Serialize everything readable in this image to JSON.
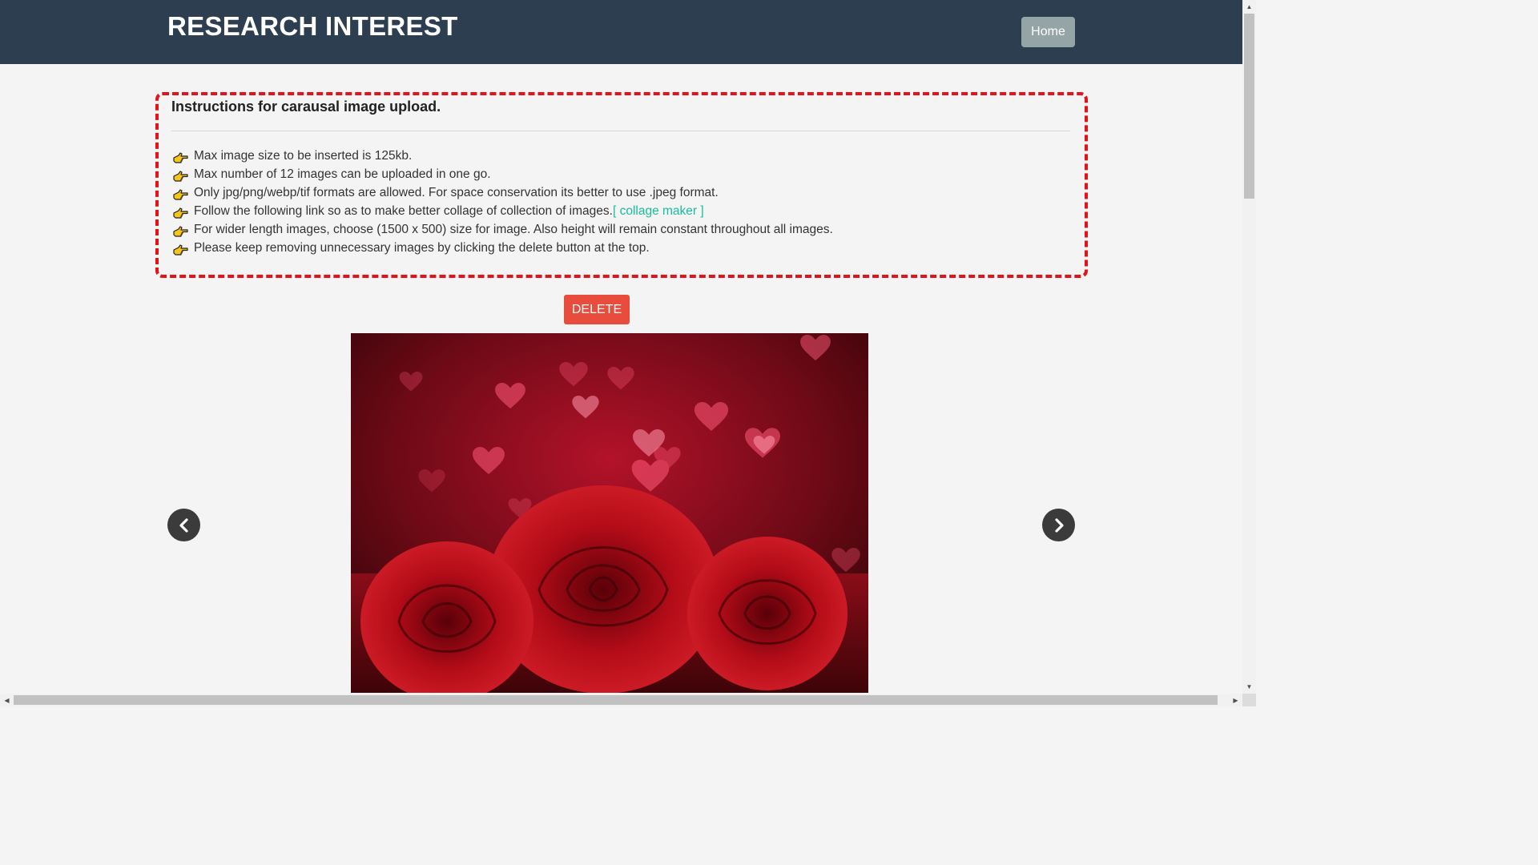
{
  "header": {
    "brand": "RESEARCH INTEREST",
    "home_label": "Home"
  },
  "instructions": {
    "title": "Instructions for carausal image upload.",
    "items": [
      {
        "text": "Max image size to be inserted is 125kb.",
        "link": ""
      },
      {
        "text": "Max number of 12 images can be uploaded in one go.",
        "link": ""
      },
      {
        "text": "Only jpg/png/webp/tif formats are allowed. For space conservation its better to use .jpeg format.",
        "link": ""
      },
      {
        "text": "Follow the following link so as to make better collage of collection of images.",
        "link": "[ collage maker ]"
      },
      {
        "text": "For wider length images, choose (1500 x 500) size for image. Also height will remain constant throughout all images.",
        "link": ""
      },
      {
        "text": "Please keep removing unnecessary images by clicking the delete button at the top.",
        "link": ""
      }
    ],
    "bullet_icon": "hand-pointing-right-icon",
    "border_color": "#e2131b"
  },
  "actions": {
    "delete_label": "DELETE"
  },
  "carousel": {
    "prev_icon": "chevron-left-icon",
    "next_icon": "chevron-right-icon"
  },
  "colors": {
    "header_bg": "#2c3e50",
    "home_btn": "#95a5a6",
    "delete_btn": "#e74c3c",
    "link": "#1abc9c"
  }
}
